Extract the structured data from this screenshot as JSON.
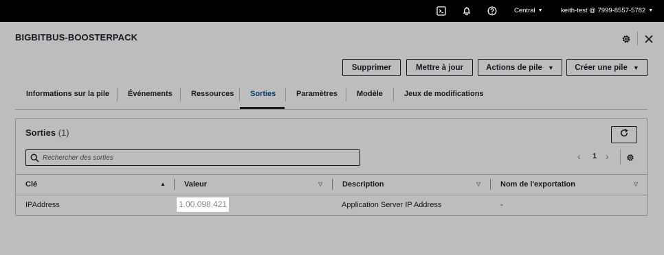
{
  "topbar": {
    "icons": [
      "cloudshell-icon",
      "notifications-icon",
      "help-icon"
    ],
    "region": "Central",
    "account": "keith-test @ 7999-8557-5782"
  },
  "stack": {
    "title": "BIGBITBUS-BOOSTERPACK"
  },
  "actions": {
    "delete": "Supprimer",
    "update": "Mettre à jour",
    "stack_actions": "Actions de pile",
    "create_stack": "Créer une pile"
  },
  "tabs": [
    {
      "label": "Informations sur la pile"
    },
    {
      "label": "Événements"
    },
    {
      "label": "Ressources"
    },
    {
      "label": "Sorties",
      "active": true
    },
    {
      "label": "Paramètres"
    },
    {
      "label": "Modèle"
    },
    {
      "label": "Jeux de modifications"
    }
  ],
  "outputs": {
    "title": "Sorties",
    "count": "(1)",
    "search_placeholder": "Rechercher des sorties",
    "page": "1",
    "columns": [
      "Clé",
      "Valeur",
      "Description",
      "Nom de l'exportation"
    ],
    "rows": [
      {
        "key": "IPAddress",
        "value": "1.00.098.421",
        "description": "Application Server IP Address",
        "export_name": "-"
      }
    ]
  },
  "colors": {
    "overlay": "#bdbdbd",
    "active_tab": "#073c70",
    "topbar": "#000000"
  }
}
